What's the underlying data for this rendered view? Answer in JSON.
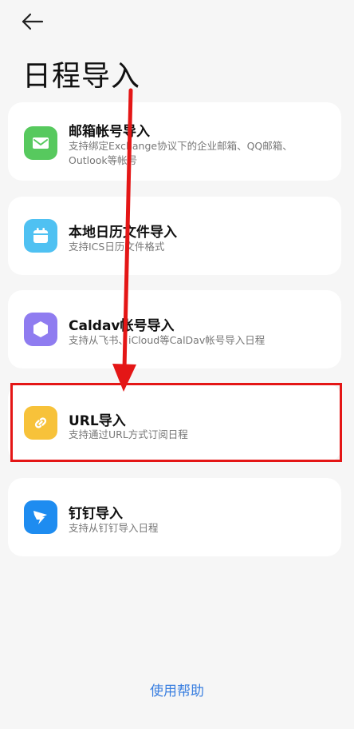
{
  "header": {
    "back_icon": "arrow-left-icon",
    "title": "日程导入"
  },
  "options": [
    {
      "id": "email",
      "title": "邮箱帐号导入",
      "desc": "支持绑定Exchange协议下的企业邮箱、QQ邮箱、Outlook等帐号",
      "icon": "mail-icon",
      "color": "#57c95e"
    },
    {
      "id": "local",
      "title": "本地日历文件导入",
      "desc": "支持ICS日历文件格式",
      "icon": "calendar-icon",
      "color": "#4fc1f2"
    },
    {
      "id": "caldav",
      "title": "Caldav帐号导入",
      "desc": "支持从飞书、iCloud等CalDav帐号导入日程",
      "icon": "hexagon-icon",
      "color": "#8f7cf0"
    },
    {
      "id": "url",
      "title": "URL导入",
      "desc": "支持通过URL方式订阅日程",
      "icon": "link-icon",
      "color": "#f7c23a"
    },
    {
      "id": "dingtalk",
      "title": "钉钉导入",
      "desc": "支持从钉钉导入日程",
      "icon": "dingtalk-icon",
      "color": "#1e8cf0"
    }
  ],
  "footer": {
    "help_label": "使用帮助"
  },
  "annotation": {
    "highlight_color": "#e41616",
    "highlight_target": "url"
  }
}
